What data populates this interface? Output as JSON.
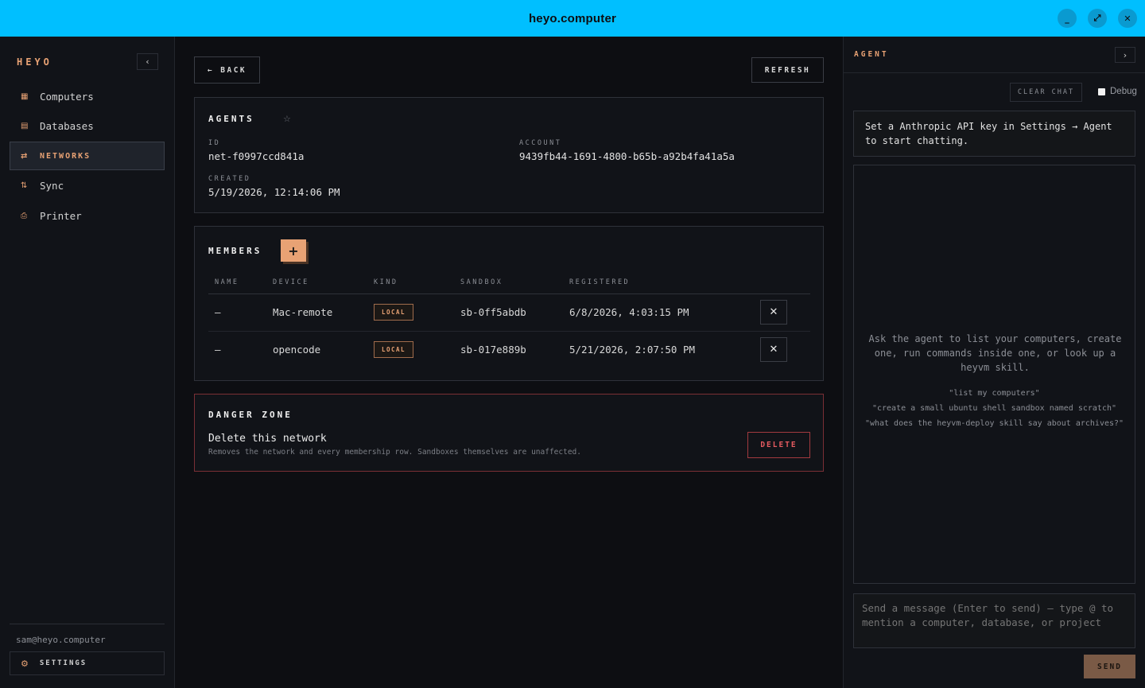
{
  "window": {
    "title": "heyo.computer",
    "controls": [
      "minimize-icon",
      "maximize-icon",
      "close-icon"
    ],
    "accent": "#00bfff"
  },
  "sidebar": {
    "brand": "HEYO",
    "collapse_icon": "‹",
    "items": [
      {
        "label": "Computers",
        "icon": "computer-icon",
        "glyph": "▦",
        "active": false
      },
      {
        "label": "Databases",
        "icon": "database-icon",
        "glyph": "▤",
        "active": false
      },
      {
        "label": "NETWORKS",
        "icon": "network-icon",
        "glyph": "⇄",
        "active": true
      },
      {
        "label": "Sync",
        "icon": "sync-icon",
        "glyph": "⇅",
        "active": false
      },
      {
        "label": "Printer",
        "icon": "printer-icon",
        "glyph": "⎙",
        "active": false
      }
    ],
    "user_email": "sam@heyo.computer",
    "settings_label": "SETTINGS",
    "accent": "#e8a274"
  },
  "main": {
    "back_label": "← BACK",
    "refresh_label": "REFRESH",
    "network": {
      "title": "AGENTS",
      "id_label": "ID",
      "id": "net-f0997ccd841a",
      "account_label": "ACCOUNT",
      "account": "9439fb44-1691-4800-b65b-a92b4fa41a5a",
      "created_label": "CREATED",
      "created": "5/19/2026, 12:14:06 PM"
    },
    "members": {
      "title": "MEMBERS",
      "columns": [
        "NAME",
        "DEVICE",
        "KIND",
        "SANDBOX",
        "REGISTERED"
      ],
      "rows": [
        {
          "name": "—",
          "device": "Mac-remote",
          "kind": "LOCAL",
          "sandbox": "sb-0ff5abdb",
          "registered": "6/8/2026, 4:03:15 PM"
        },
        {
          "name": "—",
          "device": "opencode",
          "kind": "LOCAL",
          "sandbox": "sb-017e889b",
          "registered": "5/21/2026, 2:07:50 PM"
        }
      ]
    },
    "danger": {
      "title": "DANGER ZONE",
      "heading": "Delete this network",
      "description": "Removes the network and every membership row. Sandboxes themselves are unaffected.",
      "delete_label": "DELETE",
      "color": "#e45a5f"
    }
  },
  "agent": {
    "title": "AGENT",
    "expand_icon": "›",
    "clear_label": "CLEAR CHAT",
    "debug_label": "Debug",
    "notice": "Set a Anthropic API key in Settings → Agent to start chatting.",
    "hint": "Ask the agent to list your computers, create one, run commands inside one, or look up a heyvm skill.",
    "examples": [
      "\"list my computers\"",
      "\"create a small ubuntu shell sandbox named scratch\"",
      "\"what does the heyvm-deploy skill say about archives?\""
    ],
    "input_placeholder": "Send a message (Enter to send) — type @ to mention a computer, database, or project",
    "send_label": "SEND"
  }
}
